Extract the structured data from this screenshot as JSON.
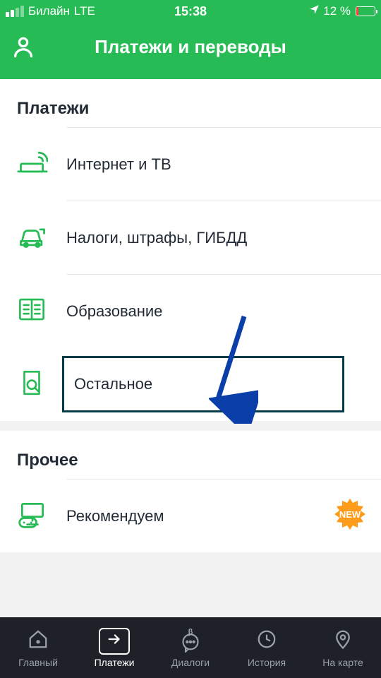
{
  "status": {
    "carrier": "Билайн",
    "network": "LTE",
    "time": "15:38",
    "battery_pct": "12 %"
  },
  "header": {
    "title": "Платежи и переводы"
  },
  "sections": {
    "payments": {
      "title": "Платежи",
      "items": [
        {
          "label": "Интернет и ТВ"
        },
        {
          "label": "Налоги, штрафы, ГИБДД"
        },
        {
          "label": "Образование"
        },
        {
          "label": "Остальное"
        }
      ]
    },
    "other": {
      "title": "Прочее",
      "items": [
        {
          "label": "Рекомендуем",
          "badge": "NEW"
        }
      ]
    }
  },
  "tabs": [
    {
      "label": "Главный"
    },
    {
      "label": "Платежи"
    },
    {
      "label": "Диалоги",
      "beta": "β"
    },
    {
      "label": "История"
    },
    {
      "label": "На карте"
    }
  ]
}
